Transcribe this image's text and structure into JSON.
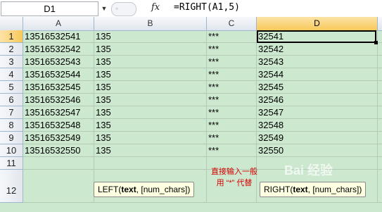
{
  "formula_bar": {
    "name_box": "D1",
    "fx_label": "fx",
    "formula": "=RIGHT(A1,5)"
  },
  "columns": [
    "A",
    "B",
    "C",
    "D"
  ],
  "rows": [
    {
      "n": "1",
      "a": "13516532541",
      "b": "135",
      "c": "***",
      "d": "32541"
    },
    {
      "n": "2",
      "a": "13516532542",
      "b": "135",
      "c": "***",
      "d": "32542"
    },
    {
      "n": "3",
      "a": "13516532543",
      "b": "135",
      "c": "***",
      "d": "32543"
    },
    {
      "n": "4",
      "a": "13516532544",
      "b": "135",
      "c": "***",
      "d": "32544"
    },
    {
      "n": "5",
      "a": "13516532545",
      "b": "135",
      "c": "***",
      "d": "32545"
    },
    {
      "n": "6",
      "a": "13516532546",
      "b": "135",
      "c": "***",
      "d": "32546"
    },
    {
      "n": "7",
      "a": "13516532547",
      "b": "135",
      "c": "***",
      "d": "32547"
    },
    {
      "n": "8",
      "a": "13516532548",
      "b": "135",
      "c": "***",
      "d": "32548"
    },
    {
      "n": "9",
      "a": "13516532549",
      "b": "135",
      "c": "***",
      "d": "32549"
    },
    {
      "n": "10",
      "a": "13516532550",
      "b": "135",
      "c": "***",
      "d": "32550"
    },
    {
      "n": "11",
      "a": "",
      "b": "",
      "c": "",
      "d": ""
    },
    {
      "n": "12",
      "a": "",
      "b": "",
      "c": "",
      "d": ""
    }
  ],
  "tooltips": {
    "left": {
      "fn": "LEFT(",
      "arg1": "text",
      "rest": ", [num_chars])"
    },
    "right": {
      "fn": "RIGHT(",
      "arg1": "text",
      "rest": ", [num_chars])"
    }
  },
  "annotation": "直接输入一般用 “*” 代替",
  "watermark": "Bai 经验",
  "colors": {
    "sheet_bg": "#cce8cf",
    "note": "#d60000",
    "active_header": "#f8c95b"
  }
}
